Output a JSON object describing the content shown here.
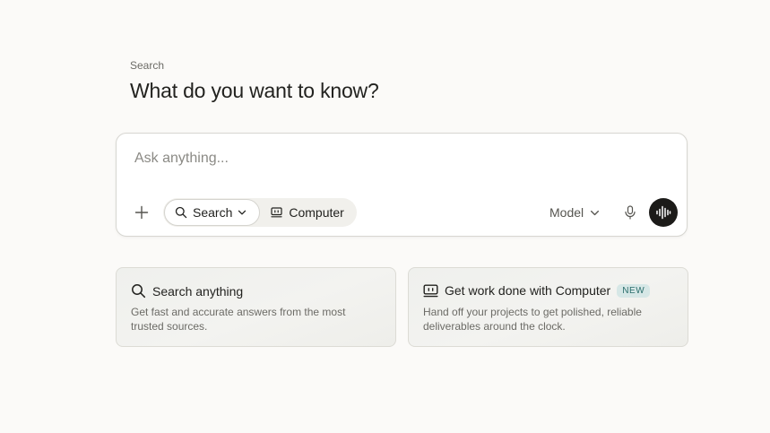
{
  "header": {
    "eyebrow": "Search",
    "title": "What do you want to know?"
  },
  "composer": {
    "placeholder": "Ask anything...",
    "add_icon": "plus-icon",
    "modes": [
      {
        "label": "Search",
        "icon": "search-icon",
        "selected": true
      },
      {
        "label": "Computer",
        "icon": "computer-icon",
        "selected": false
      }
    ],
    "model_label": "Model",
    "mic_icon": "microphone-icon",
    "voice_icon": "voice-waveform-icon"
  },
  "cards": [
    {
      "icon": "search-icon",
      "title": "Search anything",
      "description": "Get fast and accurate answers from the most trusted sources."
    },
    {
      "icon": "computer-icon",
      "title": "Get work done with Computer",
      "badge": "NEW",
      "description": "Hand off your projects to get polished, reliable deliverables around the clock."
    }
  ],
  "colors": {
    "background": "#fbfaf8",
    "voice_button": "#1c1b19",
    "badge_bg": "#d6e7e6",
    "badge_text": "#2a6e6c"
  }
}
